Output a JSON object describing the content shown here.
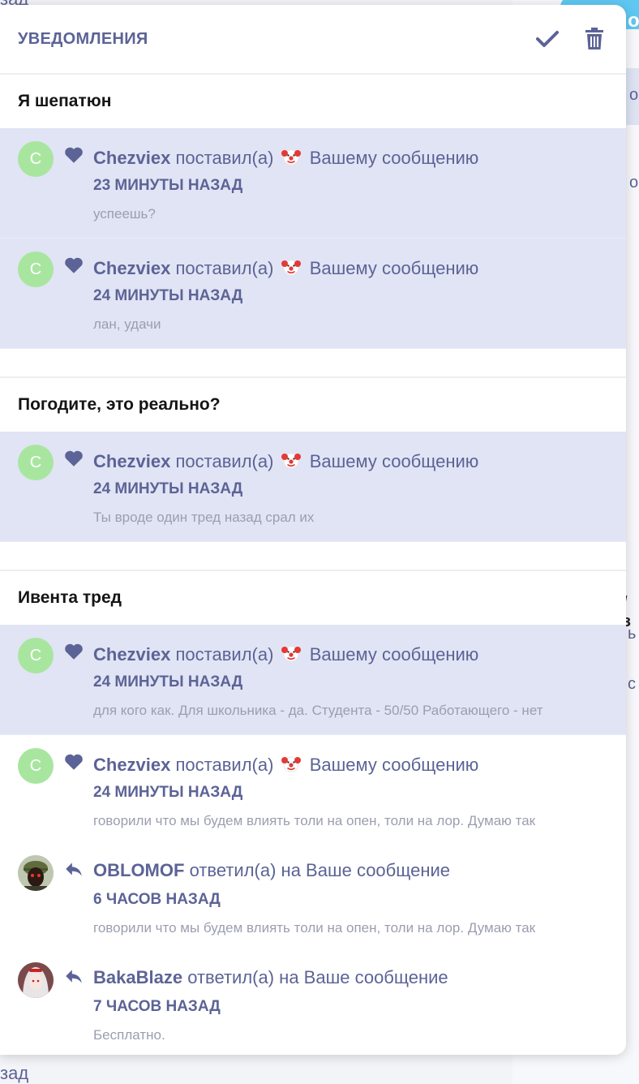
{
  "background": {
    "top_fragment": "зад",
    "bottom_fragment": "зад",
    "right_fragments": [
      "о",
      "о",
      "/ з",
      "ь",
      "с"
    ],
    "pill_text": "о"
  },
  "panel": {
    "title": "УВЕДОМЛЕНИЯ",
    "mark_read_icon": "check-icon",
    "delete_icon": "trash-icon"
  },
  "groups": [
    {
      "title": "Я шепатюн",
      "items": [
        {
          "avatar_letter": "С",
          "user": "Chezviex",
          "action": "поставил(а)",
          "target": "Вашему сообщению",
          "time": "23 МИНУТЫ НАЗАД",
          "text": "успеешь?"
        },
        {
          "avatar_letter": "С",
          "user": "Chezviex",
          "action": "поставил(а)",
          "target": "Вашему сообщению",
          "time": "24 МИНУТЫ НАЗАД",
          "text": "лан, удачи"
        }
      ]
    },
    {
      "title": "Погодите, это реально?",
      "items": [
        {
          "avatar_letter": "С",
          "user": "Chezviex",
          "action": "поставил(а)",
          "target": "Вашему сообщению",
          "time": "24 МИНУТЫ НАЗАД",
          "text": "Ты вроде один тред назад срал их"
        }
      ]
    },
    {
      "title": "Ивента тред",
      "items": [
        {
          "avatar_letter": "С",
          "user": "Chezviex",
          "action": "поставил(а)",
          "target": "Вашему сообщению",
          "time": "24 МИНУТЫ НАЗАД",
          "text": "для кого как. Для школьника - да. Студента - 50/50 Работающего - нет"
        },
        {
          "avatar_letter": "С",
          "user": "Chezviex",
          "action": "поставил(а)",
          "target": "Вашему сообщению",
          "time": "24 МИНУТЫ НАЗАД",
          "text": "говорили что мы будем влиять толи на опен, толи на лор. Думаю так"
        },
        {
          "user": "OBLOMOF",
          "action": "ответил(а) на Ваше сообщение",
          "time": "6 ЧАСОВ НАЗАД",
          "text": "говорили что мы будем влиять толи на опен, толи на лор. Думаю так"
        },
        {
          "user": "BakaBlaze",
          "action": "ответил(а) на Ваше сообщение",
          "time": "7 ЧАСОВ НАЗАД",
          "text": "Бесплатно."
        }
      ]
    }
  ],
  "colors": {
    "accent": "#5c6396",
    "unread_bg": "#e1e4f4",
    "avatar_bg": "#a8e6a0"
  }
}
